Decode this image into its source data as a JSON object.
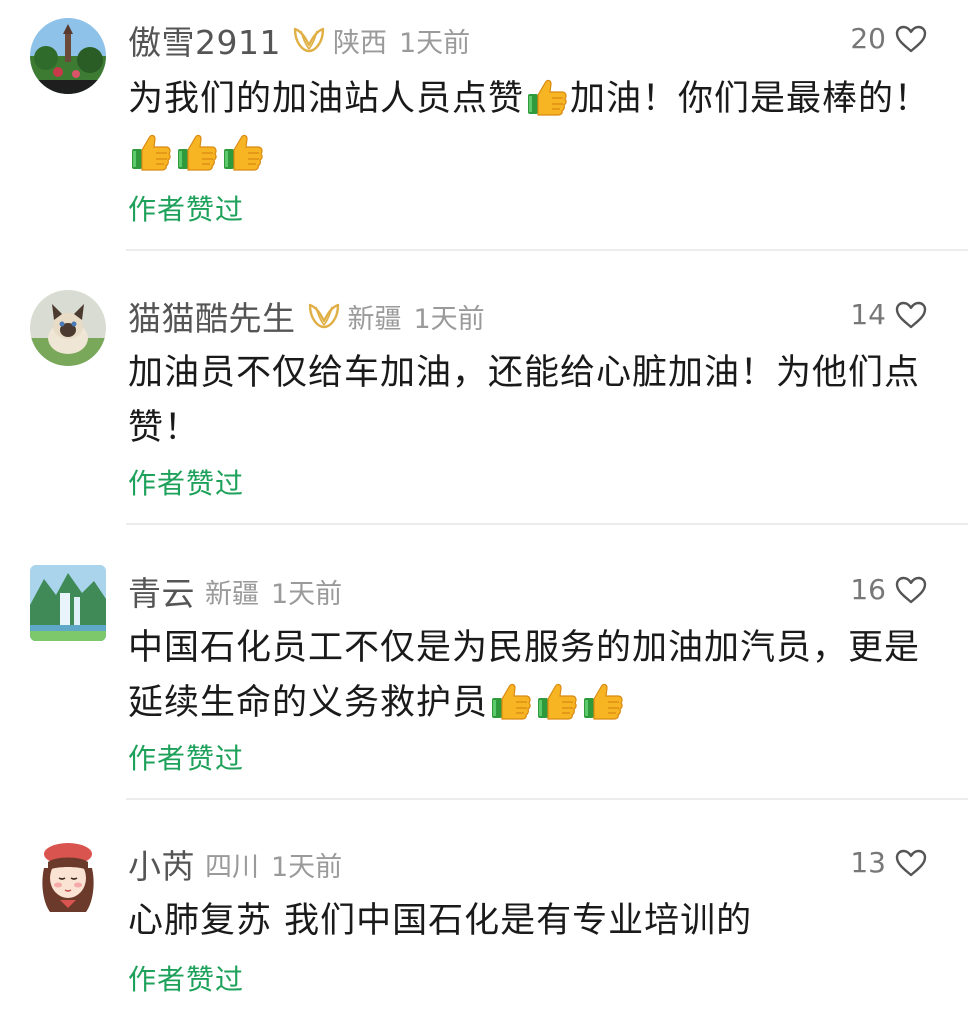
{
  "comments": [
    {
      "username": "傲雪2911",
      "has_badge": true,
      "region": "陕西",
      "time": "1天前",
      "likes": "20",
      "text_a": "为我们的加油站人员点赞",
      "text_b": "加油！你们是最棒的！",
      "author_liked": "作者赞过",
      "avatar": "landscape-avatar"
    },
    {
      "username": "猫猫酷先生",
      "has_badge": true,
      "region": "新疆",
      "time": "1天前",
      "likes": "14",
      "text_a": "加油员不仅给车加油，还能给心脏加油！为他们点赞！",
      "author_liked": "作者赞过",
      "avatar": "cat-avatar"
    },
    {
      "username": "青云",
      "has_badge": false,
      "region": "新疆",
      "time": "1天前",
      "likes": "16",
      "text_a": "中国石化员工不仅是为民服务的加油加汽员，更是延续生命的义务救护员",
      "author_liked": "作者赞过",
      "avatar": "waterfall-avatar"
    },
    {
      "username": "小芮",
      "has_badge": false,
      "region": "四川",
      "time": "1天前",
      "likes": "13",
      "text_a": "心肺复苏 我们中国石化是有专业培训的",
      "author_liked": "作者赞过",
      "avatar": "girl-avatar"
    }
  ],
  "colors": {
    "author_liked": "#1ea15a",
    "badge": "#e0b046",
    "meta_gray": "#9a9a9a"
  },
  "icons": [
    "heart-outline-icon",
    "thumbs-up-emoji",
    "vip-badge-icon"
  ]
}
